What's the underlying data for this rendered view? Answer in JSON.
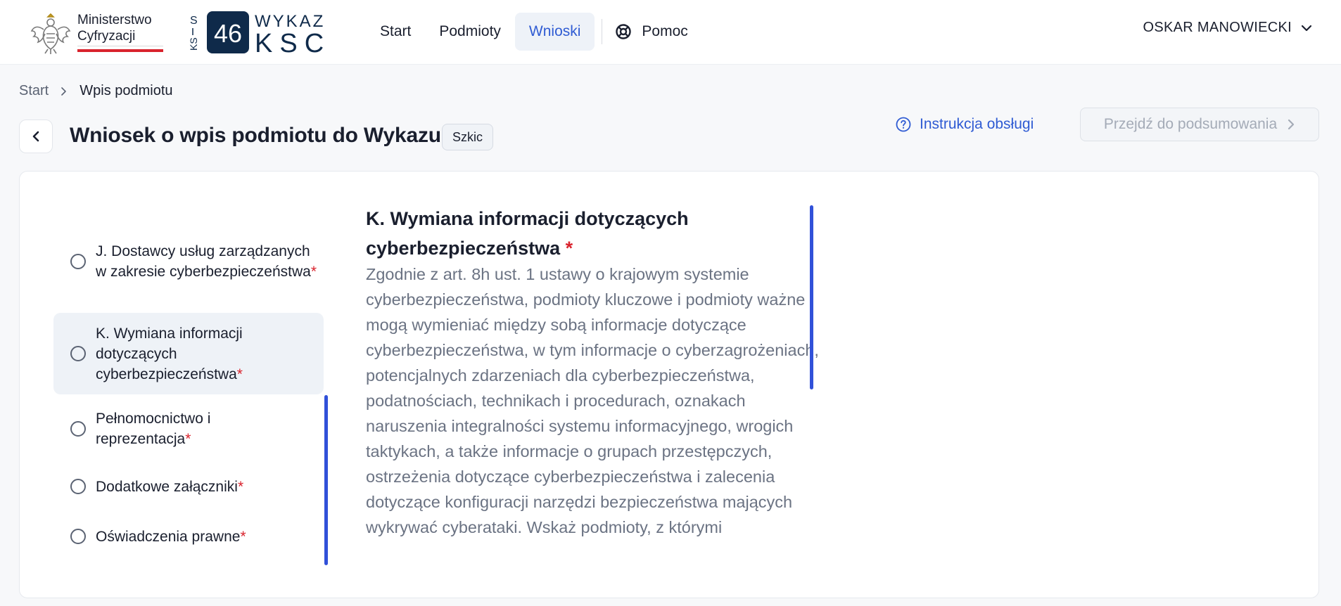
{
  "header": {
    "ministry_line1": "Ministerstwo",
    "ministry_line2": "Cyfryzacji",
    "logo_s": "S",
    "logo_ks": "KS",
    "logo_number": "46",
    "logo_wykaz": "WYKAZ",
    "logo_ksc": "KSC",
    "nav": {
      "start": "Start",
      "podmioty": "Podmioty",
      "wnioski": "Wnioski",
      "pomoc": "Pomoc"
    },
    "user_name": "OSKAR MANOWIECKI"
  },
  "breadcrumb": {
    "start": "Start",
    "current": "Wpis podmiotu"
  },
  "page": {
    "title": "Wniosek o wpis podmiotu do Wykazu",
    "status": "Szkic",
    "instruction_link": "Instrukcja obsługi",
    "summary_button": "Przejdź do podsumowania"
  },
  "steps": [
    {
      "label": "J. Dostawcy usług zarządzanych w zakresie cyberbezpieczeństwa",
      "required": "*"
    },
    {
      "label": "K. Wymiana informacji dotyczących cyberbezpieczeństwa",
      "required": "*"
    },
    {
      "label": "Pełnomocnictwo i reprezentacja",
      "required": "*"
    },
    {
      "label": "Dodatkowe załączniki",
      "required": "*"
    },
    {
      "label": "Oświadczenia prawne",
      "required": "*"
    }
  ],
  "section": {
    "title": "K. Wymiana informacji dotyczących cyberbezpieczeństwa",
    "required": "*",
    "text": "Zgodnie z art. 8h ust. 1 ustawy o krajowym systemie cyberbezpieczeństwa, podmioty kluczowe i podmioty ważne mogą wymieniać między sobą informacje dotyczące cyberbezpieczeństwa, w tym informacje o cyberzagrożeniach, potencjalnych zdarzeniach dla cyberbezpieczeństwa, podatnościach, technikach i procedurach, oznakach naruszenia integralności systemu informacyjnego, wrogich taktykach, a także informacje o grupach przestępczych, ostrzeżenia dotyczące cyberbezpieczeństwa i zalecenia dotyczące konfiguracji narzędzi bezpieczeństwa mających wykrywać cyberataki. Wskaż podmioty, z którymi"
  },
  "colors": {
    "accent": "#2f5bd3",
    "scrollbar": "#3151d9",
    "required": "#d9232d",
    "active_bg": "#eef2f7"
  }
}
